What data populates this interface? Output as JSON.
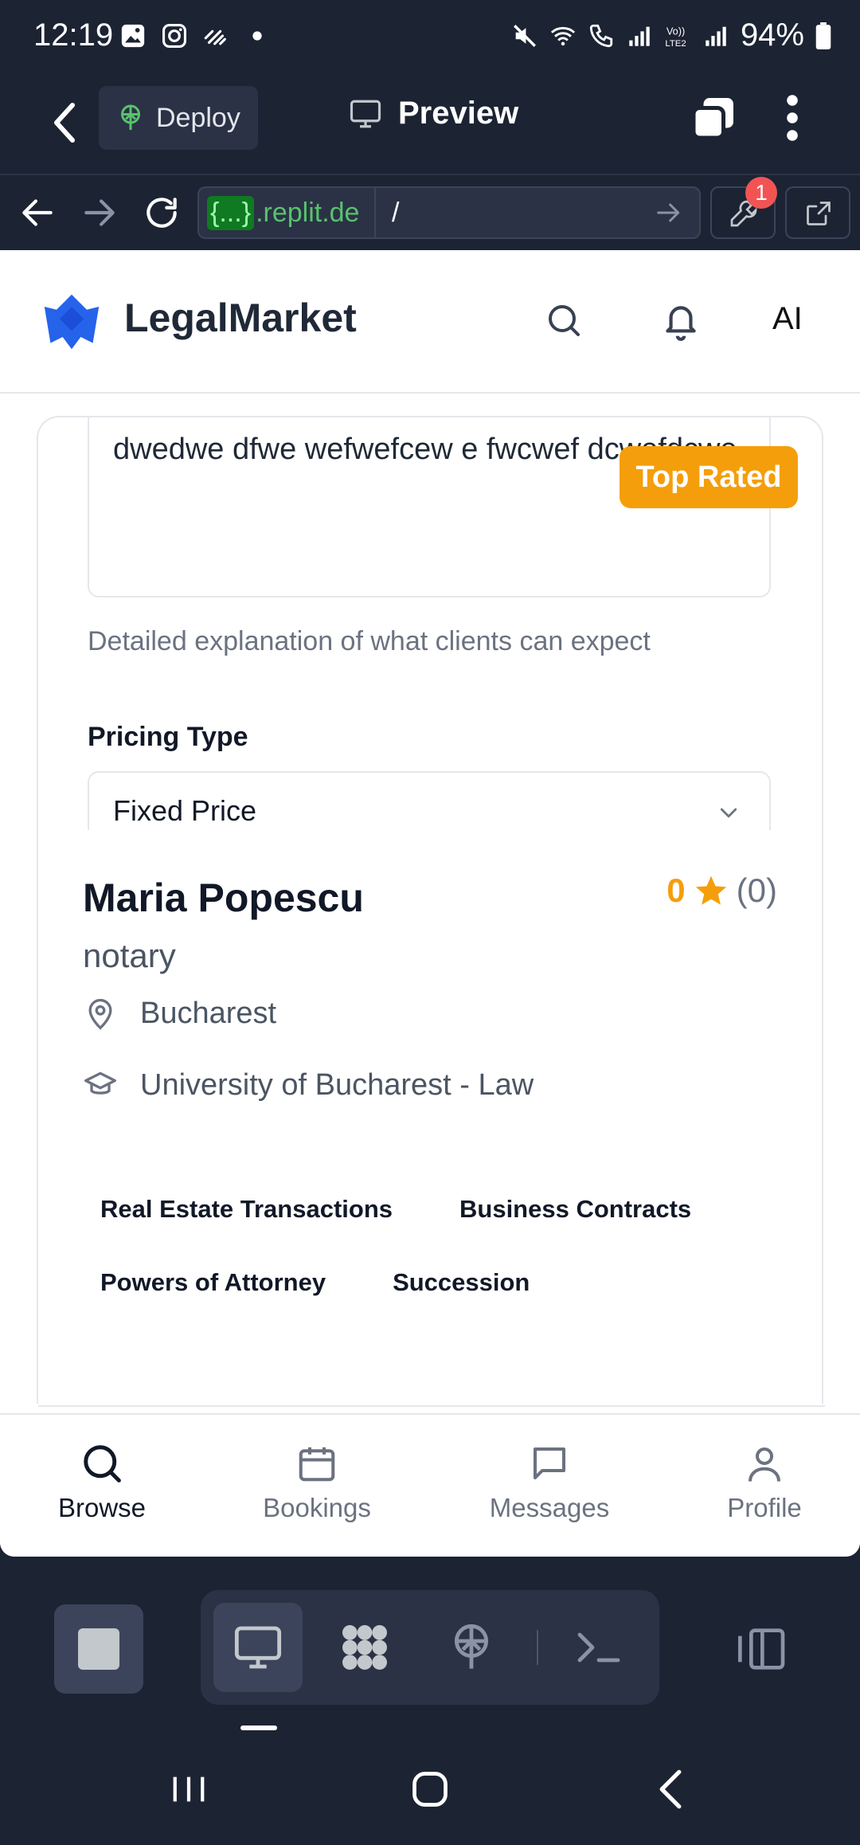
{
  "status_bar": {
    "time": "12:19",
    "battery": "94%"
  },
  "replit_toolbar": {
    "deploy_label": "Deploy",
    "preview_label": "Preview",
    "devtools_badge": "1"
  },
  "url_bar": {
    "domain_badge": "{...}",
    "domain_text": ".replit.de",
    "path": "/"
  },
  "app": {
    "brand": "LegalMarket",
    "ai_label": "AI",
    "form": {
      "description_text": "dwedwe dfwe wefwefcew e fwcwef dcwefdcwe",
      "description_hint": "Detailed explanation of what clients can expect",
      "pricing_type_label": "Pricing Type",
      "pricing_type_value": "Fixed Price"
    },
    "badge": "Top Rated",
    "profile": {
      "name": "Maria Popescu",
      "role": "notary",
      "rating_value": "0",
      "rating_count": "(0)",
      "location": "Bucharest",
      "education": "University of Bucharest - Law",
      "specialties": [
        "Real Estate Transactions",
        "Business Contracts",
        "Powers of Attorney",
        "Succession"
      ]
    },
    "bottom_nav": [
      {
        "label": "Browse",
        "icon": "search-icon"
      },
      {
        "label": "Bookings",
        "icon": "calendar-icon"
      },
      {
        "label": "Messages",
        "icon": "chat-icon"
      },
      {
        "label": "Profile",
        "icon": "user-icon"
      }
    ]
  },
  "colors": {
    "replit_bg": "#1c2333",
    "accent_amber": "#f59e0b",
    "logo_blue": "#2563eb",
    "url_green": "#58c26e"
  }
}
